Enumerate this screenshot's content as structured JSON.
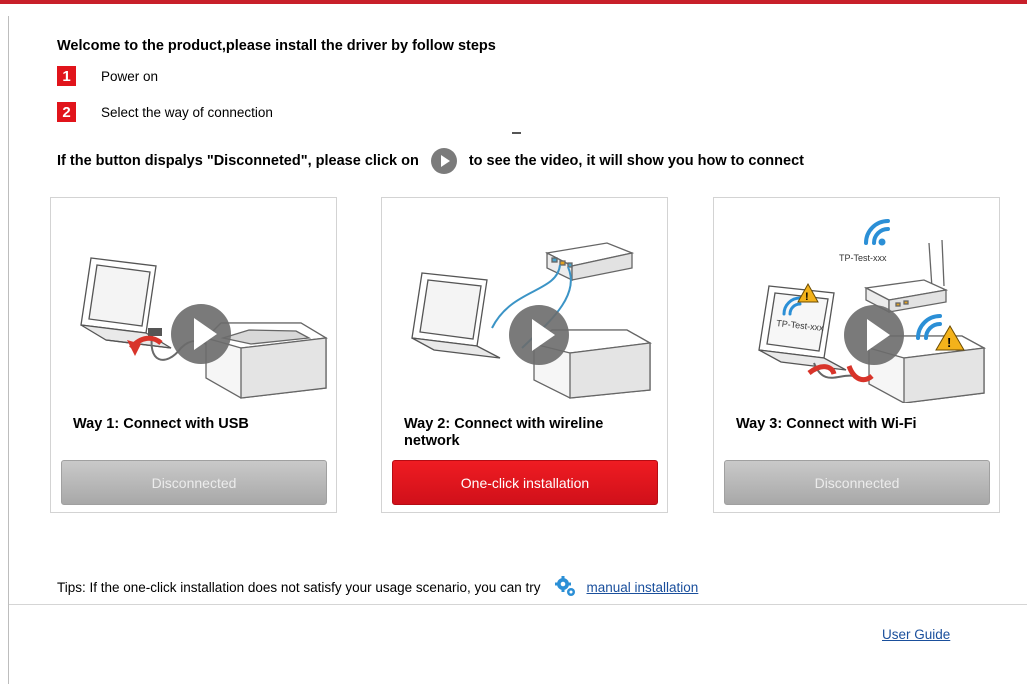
{
  "header": {
    "welcome": "Welcome to the product,please install the driver by follow steps"
  },
  "steps": [
    {
      "number": "1",
      "text": "Power on"
    },
    {
      "number": "2",
      "text": "Select the way of connection"
    }
  ],
  "hint": {
    "before": "If the button dispalys \"Disconneted\", please click on",
    "after": "to see the video, it will show you how to connect",
    "icon": "play-icon"
  },
  "ways": [
    {
      "title": "Way 1: Connect with USB",
      "button": "Disconnected",
      "state": "disabled"
    },
    {
      "title": "Way 2: Connect with wireline network",
      "button": "One-click installation",
      "state": "active"
    },
    {
      "title": "Way 3: Connect with Wi-Fi",
      "button": "Disconnected",
      "state": "disabled",
      "ssid": "TP-Test-xxx"
    }
  ],
  "tips": {
    "text": "Tips: If the one-click installation does not satisfy your usage scenario, you can try",
    "link": "manual installation",
    "icon": "gear-icon"
  },
  "footer": {
    "user_guide": "User Guide"
  },
  "colors": {
    "accent": "#e1141b",
    "disabled": "#b0b0b0",
    "link": "#1a4f9c"
  }
}
